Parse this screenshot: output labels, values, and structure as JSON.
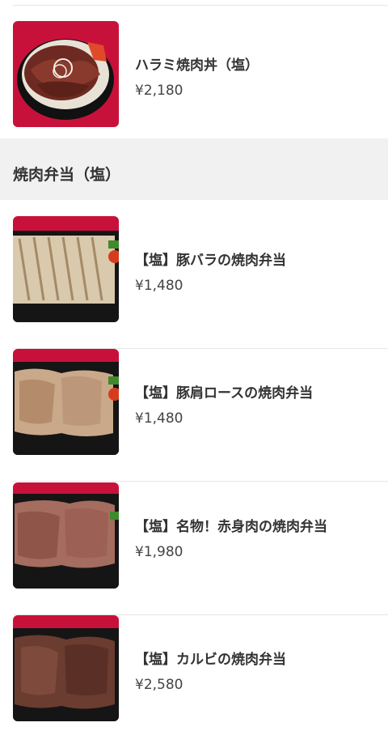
{
  "top_item": {
    "name": "ハラミ焼肉丼（塩）",
    "price": "¥2,180",
    "image": "harami-yakiniku-don-photo"
  },
  "section": {
    "title": "焼肉弁当（塩）",
    "items": [
      {
        "name": "【塩】豚バラの焼肉弁当",
        "price": "¥1,480",
        "image": "pork-belly-bento-photo"
      },
      {
        "name": "【塩】豚肩ロースの焼肉弁当",
        "price": "¥1,480",
        "image": "pork-shoulder-bento-photo"
      },
      {
        "name": "【塩】名物！赤身肉の焼肉弁当",
        "price": "¥1,980",
        "image": "lean-beef-bento-photo"
      },
      {
        "name": "【塩】カルビの焼肉弁当",
        "price": "¥2,580",
        "image": "kalbi-bento-photo"
      }
    ]
  },
  "colors": {
    "photo_background": "#c8113a",
    "section_background": "#f1f1f1",
    "divider": "#e6e6e6"
  }
}
